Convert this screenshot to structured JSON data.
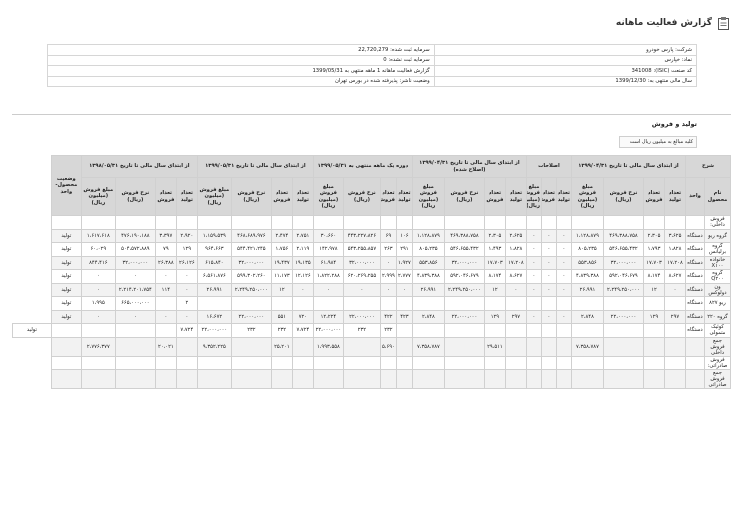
{
  "page": {
    "title": "گزارش فعالیت ماهانه"
  },
  "company": {
    "company_label": "شرکت:",
    "company_value": "پارس خودرو",
    "symbol_label": "نماد:",
    "symbol_value": "خپارس",
    "isic_label": "کد صنعت (ISIC):",
    "isic_value": "341008",
    "fiscal_label": "سال مالی منتهی به:",
    "fiscal_value": "1399/12/30",
    "capital_label": "سرمایه ثبت شده:",
    "capital_value": "22,720,279",
    "unreg_label": "سرمایه ثبت نشده:",
    "unreg_value": "0",
    "period_label": "گزارش فعالیت ماهانه 1 ماهه منتهی به 1399/05/31",
    "status_label": "وضعیت ناشر:",
    "status_value": "پذیرفته شده در بورس تهران"
  },
  "section": {
    "title": "تولید و فروش",
    "note": "کلیه مبالغ به میلیون ریال است"
  },
  "table": {
    "group_headers": [
      "شرح",
      "از ابتدای سال مالی تا تاریخ ۱۳۹۹/۰۴/۳۱",
      "اصلاحات",
      "از ابتدای سال مالی تا تاریخ ۱۳۹۹/۰۴/۳۱ (اصلاح شده)",
      "دوره یک ماهه منتهی به ۱۳۹۹/۰۵/۳۱",
      "از ابتدای سال مالی تا تاریخ ۱۳۹۹/۰۵/۳۱",
      "از ابتدای سال مالی تا تاریخ ۱۳۹۸/۰۵/۳۱",
      "وضعیت محصول-واحد"
    ],
    "sub_headers": [
      "نام محصول",
      "واحد",
      "تعداد تولید",
      "تعداد فروش",
      "نرخ فروش (ریال)",
      "مبلغ فروش (میلیون ریال)",
      "تعداد تولید",
      "تعداد فروش",
      "مبلغ فروش (میلیون ریال)",
      "تعداد تولید",
      "تعداد فروش",
      "نرخ فروش (ریال)",
      "مبلغ فروش (میلیون ریال)",
      "تعداد تولید",
      "تعداد فروش",
      "نرخ فروش (ریال)",
      "مبلغ فروش (میلیون ریال)",
      "تعداد تولید",
      "تعداد فروش",
      "نرخ فروش (ریال)",
      "مبلغ فروش (میلیون ریال)",
      "تعداد تولید",
      "تعداد فروش",
      "نرخ فروش (ریال)",
      "مبلغ فروش (میلیون ریال)"
    ],
    "rows": [
      [
        "فروش داخلی:",
        "",
        "",
        "",
        "",
        "",
        "",
        "",
        "",
        "",
        "",
        "",
        "",
        "",
        "",
        "",
        "",
        "",
        "",
        "",
        "",
        "",
        "",
        "",
        "",
        ""
      ],
      [
        "گروه ریو",
        "دستگاه",
        "۳،۶۲۵",
        "۲،۳۰۵",
        "۴۶۹،۳۸۸،۷۵۸",
        "۱،۱۲۸،۸۷۹",
        "۰",
        "۰",
        "۰",
        "۲،۶۲۵",
        "۲،۳۰۵",
        "۴۶۹،۳۸۸،۷۵۸",
        "۱،۱۲۸،۸۷۹",
        "۱۰۶",
        "۶۹",
        "۴۴۳،۲۲۷،۸۲۶",
        "۳۰،۶۶۰",
        "۲،۷۵۱",
        "۲،۴۷۴",
        "۴۶۸،۶۸۹،۹۷۶",
        "۱،۱۵۹،۵۳۹",
        "۲،۹۲۰",
        "۳،۳۹۷",
        "۴۷۶،۱۹۰،۱۸۸",
        "۱،۶۱۷،۶۱۸",
        "تولید"
      ],
      [
        "گروه برلیانس",
        "دستگاه",
        "۱،۸۲۸",
        "۱،۷۹۳",
        "۵۴۶،۶۵۵،۴۳۲",
        "۸۰۵،۲۳۵",
        "۰",
        "۰",
        "۰",
        "۱،۸۲۸",
        "۱،۴۹۳",
        "۵۴۶،۶۵۵،۴۳۲",
        "۸۰۵،۲۳۵",
        "۲۹۱",
        "۲۶۳",
        "۵۴۳،۲۵۵،۸۵۷",
        "۱۴۲،۹۷۸",
        "۲،۱۱۹",
        "۱،۷۵۶",
        "۵۴۴،۴۲۱،۲۴۵",
        "۹۶۴،۶۶۳",
        "۱۲۹",
        "۷۹",
        "۵۰۴،۵۷۲،۸۸۹",
        "۶۰،۰۲۹",
        "تولید"
      ],
      [
        "خانواده X۱۰۰",
        "دستگاه",
        "۱۷،۲۰۸",
        "۱۷،۷۰۳",
        "۳۲،۰۰۰،۰۰۰",
        "۵۵۳،۸۵۶",
        "۰",
        "۰",
        "۰",
        "۱۷،۲۰۸",
        "۱۷،۷۰۳",
        "۳۲،۰۰۰،۰۰۰",
        "۵۵۳،۸۵۶",
        "۱،۹۲۷",
        "۰",
        "۳۲،۰۰۰،۰۰۰",
        "۶۱،۹۸۴",
        "۱۹،۱۳۵",
        "۱۹،۴۳۷",
        "۳۲،۰۰۰،۰۰۰",
        "۶۱۵،۸۴۰",
        "۲۶،۱۲۶",
        "۲۶،۳۸۸",
        "۳۲،۰۰۰،۰۰۰",
        "۸۴۴،۴۱۶",
        "تولید"
      ],
      [
        "گروه Q۲۰۰",
        "دستگاه",
        "۸،۶۲۷",
        "۸،۱۷۴",
        "۵۹۲،۰۴۶،۶۷۹",
        "۴،۸۳۹،۳۸۸",
        "۰",
        "۰",
        "۰",
        "۸،۶۲۷",
        "۸،۱۷۴",
        "۵۹۲،۰۴۶،۶۷۹",
        "۴،۸۳۹،۳۸۸",
        "۲،۷۷۷",
        "۲،۹۹۹",
        "۶۲۰،۲۶۹،۲۵۵",
        "۱،۸۲۲،۲۸۸",
        "۱۲،۱۲۶",
        "۱۱،۱۷۳",
        "۵۹۹،۳۰۲،۲۶۰",
        "۶،۵۶۱،۸۷۶",
        "۰",
        "۰",
        "۰",
        "۰",
        "تولید"
      ],
      [
        "ون دولوکس",
        "دستگاه",
        "۰",
        "۱۲",
        "۲،۲۴۹،۲۵۰،۰۰۰",
        "۲۶،۹۹۱",
        "۰",
        "۰",
        "۰",
        "۰",
        "۱۲",
        "۲،۲۴۹،۲۵۰،۰۰۰",
        "۲۶،۹۹۱",
        "۰",
        "۰",
        "۰",
        "۰",
        "۰",
        "۱۲",
        "۲،۲۴۹،۲۵۰،۰۰۰",
        "۲۶،۹۹۱",
        "۰",
        "۱۱۴",
        "۲،۲۱۴،۲۰۱،۷۵۴",
        "۰",
        "تولید"
      ],
      [
        "ریو ۸۲۷",
        "دستگاه",
        "",
        "",
        "",
        "",
        "",
        "",
        "",
        "",
        "",
        "",
        "",
        "",
        "",
        "",
        "",
        "",
        "",
        "",
        "",
        "۲",
        "",
        "۶۶۵،۰۰۰،۰۰۰",
        "۱،۹۹۵",
        "تولید"
      ],
      [
        "گروه ۲۲۰",
        "دستگاه",
        "۲۹۷",
        "۱۲۹",
        "۲۲،۰۰۰،۰۰۰",
        "۲،۸۴۸",
        "۰",
        "۰",
        "۰",
        "۲۹۷",
        "۱۲۹",
        "۲۲،۰۰۰،۰۰۰",
        "۲،۸۴۸",
        "۴۲۳",
        "۴۲۲",
        "۲۲،۰۰۰،۰۰۰",
        "۱۲،۲۲۴",
        "۷۲۰",
        "۵۵۱",
        "۲۲،۰۰۰،۰۰۰",
        "۱۶،۶۷۲",
        "۰",
        "۰",
        "۰",
        "۰",
        "تولید"
      ],
      [
        "کوئیک متمولی",
        "دستگاه",
        "",
        "",
        "",
        "",
        "",
        "",
        "",
        "",
        "",
        "",
        "",
        "",
        "۲۳۲",
        "۲۳۲",
        "۲۲،۰۰۰،۰۰۰",
        "۷،۷۲۴",
        "۲۳۲",
        "۲۳۲",
        "۲۲،۰۰۰،۰۰۰",
        "۷،۷۲۴",
        "",
        "",
        "",
        "",
        "تولید"
      ],
      [
        "جمع فروش داخلی",
        "",
        "",
        "",
        "",
        "۷،۳۵۸،۷۸۷",
        "",
        "",
        "",
        "",
        "۲۹،۵۱۱",
        "",
        "۷،۳۵۸،۷۸۷",
        "",
        "۵،۶۹۰",
        "",
        "۱،۹۹۳،۵۵۸",
        "",
        "۲۵،۲۰۱",
        "",
        "۹،۳۵۲،۲۲۵",
        "",
        "۲۰،۰۲۱",
        "",
        "۲،۷۷۶،۳۷۷",
        ""
      ],
      [
        "فروش صادراتی:",
        "",
        "",
        "",
        "",
        "",
        "",
        "",
        "",
        "",
        "",
        "",
        "",
        "",
        "",
        "",
        "",
        "",
        "",
        "",
        "",
        "",
        "",
        "",
        "",
        ""
      ],
      [
        "جمع فروش صادراتی",
        "",
        "",
        "",
        "",
        "",
        "",
        "",
        "",
        "",
        "",
        "",
        "",
        "",
        "",
        "",
        "",
        "",
        "",
        "",
        "",
        "",
        "",
        "",
        "",
        ""
      ]
    ]
  }
}
